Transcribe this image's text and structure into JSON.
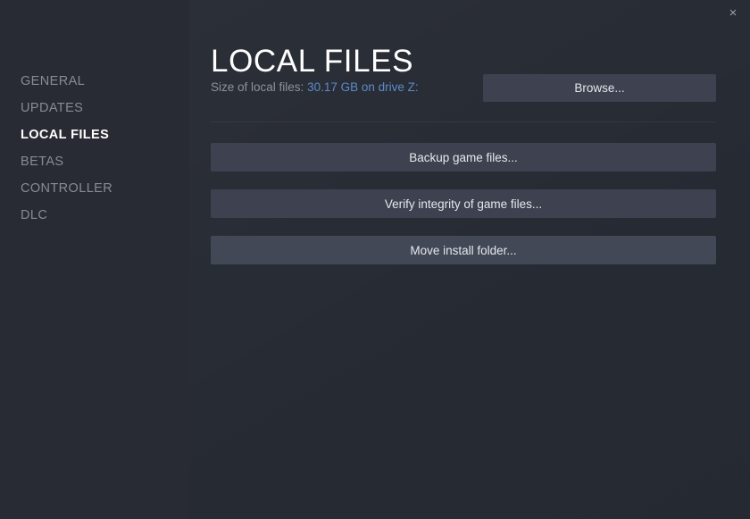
{
  "window": {
    "close_icon": "close-icon",
    "close_label": "×"
  },
  "sidebar": {
    "items": [
      {
        "label": "GENERAL",
        "selected": false
      },
      {
        "label": "UPDATES",
        "selected": false
      },
      {
        "label": "LOCAL FILES",
        "selected": true
      },
      {
        "label": "BETAS",
        "selected": false
      },
      {
        "label": "CONTROLLER",
        "selected": false
      },
      {
        "label": "DLC",
        "selected": false
      }
    ]
  },
  "main": {
    "title": "LOCAL FILES",
    "size_row": {
      "label": "Size of local files:",
      "value": "30.17 GB on drive Z:"
    },
    "browse_label": "Browse...",
    "actions": [
      {
        "label": "Backup game files..."
      },
      {
        "label": "Verify integrity of game files..."
      },
      {
        "label": "Move install folder..."
      }
    ]
  },
  "colors": {
    "panel_bg": "#262a33",
    "sidebar_bg": "#282b33",
    "button_bg": "#3e4250",
    "button_hover_bg": "#434857",
    "accent_blue": "#5d8ac9",
    "text_muted": "#8d929b",
    "text_primary": "#ffffff"
  }
}
